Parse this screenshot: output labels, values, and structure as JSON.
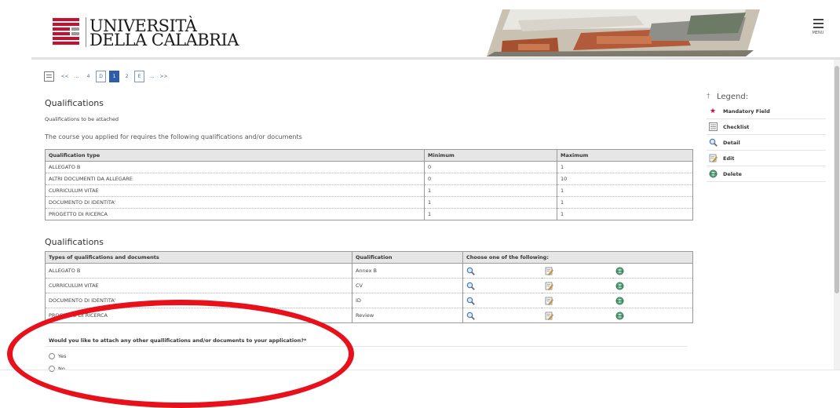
{
  "header": {
    "logo_line1": "UNIVERSITÀ",
    "logo_line2": "DELLA CALABRIA",
    "menu_label": "MENU",
    "brand_color": "#c8102e"
  },
  "pager": {
    "items": [
      "<<",
      "...",
      "4",
      "D",
      "1",
      "2",
      "E",
      "...",
      ">>"
    ],
    "active": "1"
  },
  "section1": {
    "title": "Qualifications",
    "subtitle": "Qualifications to be attached",
    "intro": "The course you applied for requires the following qualifications and/or documents",
    "headers": [
      "Qualification type",
      "Minimum",
      "Maximum"
    ],
    "rows": [
      [
        "ALLEGATO B",
        "0",
        "1"
      ],
      [
        "ALTRI DOCUMENTI DA ALLEGARE",
        "0",
        "10"
      ],
      [
        "CURRICULUM VITAE",
        "1",
        "1"
      ],
      [
        "DOCUMENTO DI IDENTITA'",
        "1",
        "1"
      ],
      [
        "PROGETTO DI RICERCA",
        "1",
        "1"
      ]
    ]
  },
  "section2": {
    "title": "Qualifications",
    "headers": [
      "Types of qualifications and documents",
      "Qualification",
      "Choose one of the following:"
    ],
    "rows": [
      [
        "ALLEGATO B",
        "Annex B"
      ],
      [
        "CURRICULUM VITAE",
        "CV"
      ],
      [
        "DOCUMENTO DI IDENTITA'",
        "ID"
      ],
      [
        "PROGETTO DI RICERCA",
        "Review"
      ]
    ]
  },
  "question": {
    "text": "Would you like to attach any other quallifications and/or documents to your application?*",
    "options": [
      "Yes",
      "No"
    ]
  },
  "legend": {
    "title": "Legend:",
    "items": [
      {
        "icon": "mandatory-star-icon",
        "label": "Mandatory Field"
      },
      {
        "icon": "checklist-icon",
        "label": "Checklist"
      },
      {
        "icon": "magnifier-icon",
        "label": "Detail"
      },
      {
        "icon": "edit-icon",
        "label": "Edit"
      },
      {
        "icon": "delete-icon",
        "label": "Delete"
      }
    ]
  },
  "annotation_color": "#e8101a"
}
